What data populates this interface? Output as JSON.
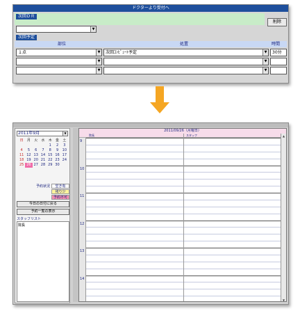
{
  "form": {
    "title": "ドクターより受付へ",
    "section1_label": "次回ＤＲ",
    "combo_value": "",
    "delete_label": "削除",
    "section2_label": "次回予定",
    "col_part": "部位",
    "col_content": "処置",
    "col_time": "時間",
    "rows": [
      {
        "part": "１点",
        "content": "次回ｺﾝﾋﾟｭｰﾄ予定",
        "time": "30分"
      },
      {
        "part": "",
        "content": "",
        "time": ""
      },
      {
        "part": "",
        "content": "",
        "time": ""
      }
    ]
  },
  "calendar": {
    "month_label": "2011年9月",
    "weekday_heads": [
      "日",
      "月",
      "火",
      "水",
      "木",
      "金",
      "土"
    ],
    "weeks": [
      [
        "",
        "",
        "",
        "",
        "1",
        "2",
        "3"
      ],
      [
        "4",
        "5",
        "6",
        "7",
        "8",
        "9",
        "10"
      ],
      [
        "11",
        "12",
        "13",
        "14",
        "15",
        "16",
        "17"
      ],
      [
        "18",
        "19",
        "20",
        "21",
        "22",
        "23",
        "24"
      ],
      [
        "25",
        "26",
        "27",
        "28",
        "29",
        "30",
        ""
      ]
    ],
    "selected_day": "26",
    "legend": [
      {
        "label": "予約状況",
        "chip": "空き有",
        "color": "#ffffff"
      },
      {
        "label": "",
        "chip": "残り少",
        "color": "#fff59d"
      },
      {
        "label": "",
        "chip": "予約不可",
        "color": "#f48fb1"
      }
    ],
    "today_button": "今日の日付に戻る",
    "list_button": "予約一覧の表示",
    "staff_title": "スタッフリスト",
    "staff_list": [
      "院長"
    ],
    "date_header": "2011/09/26（月曜日）",
    "column_heads": [
      "院長",
      "スタッフ"
    ],
    "hours": [
      "9",
      "10",
      "11",
      "12",
      "13",
      "14"
    ]
  }
}
